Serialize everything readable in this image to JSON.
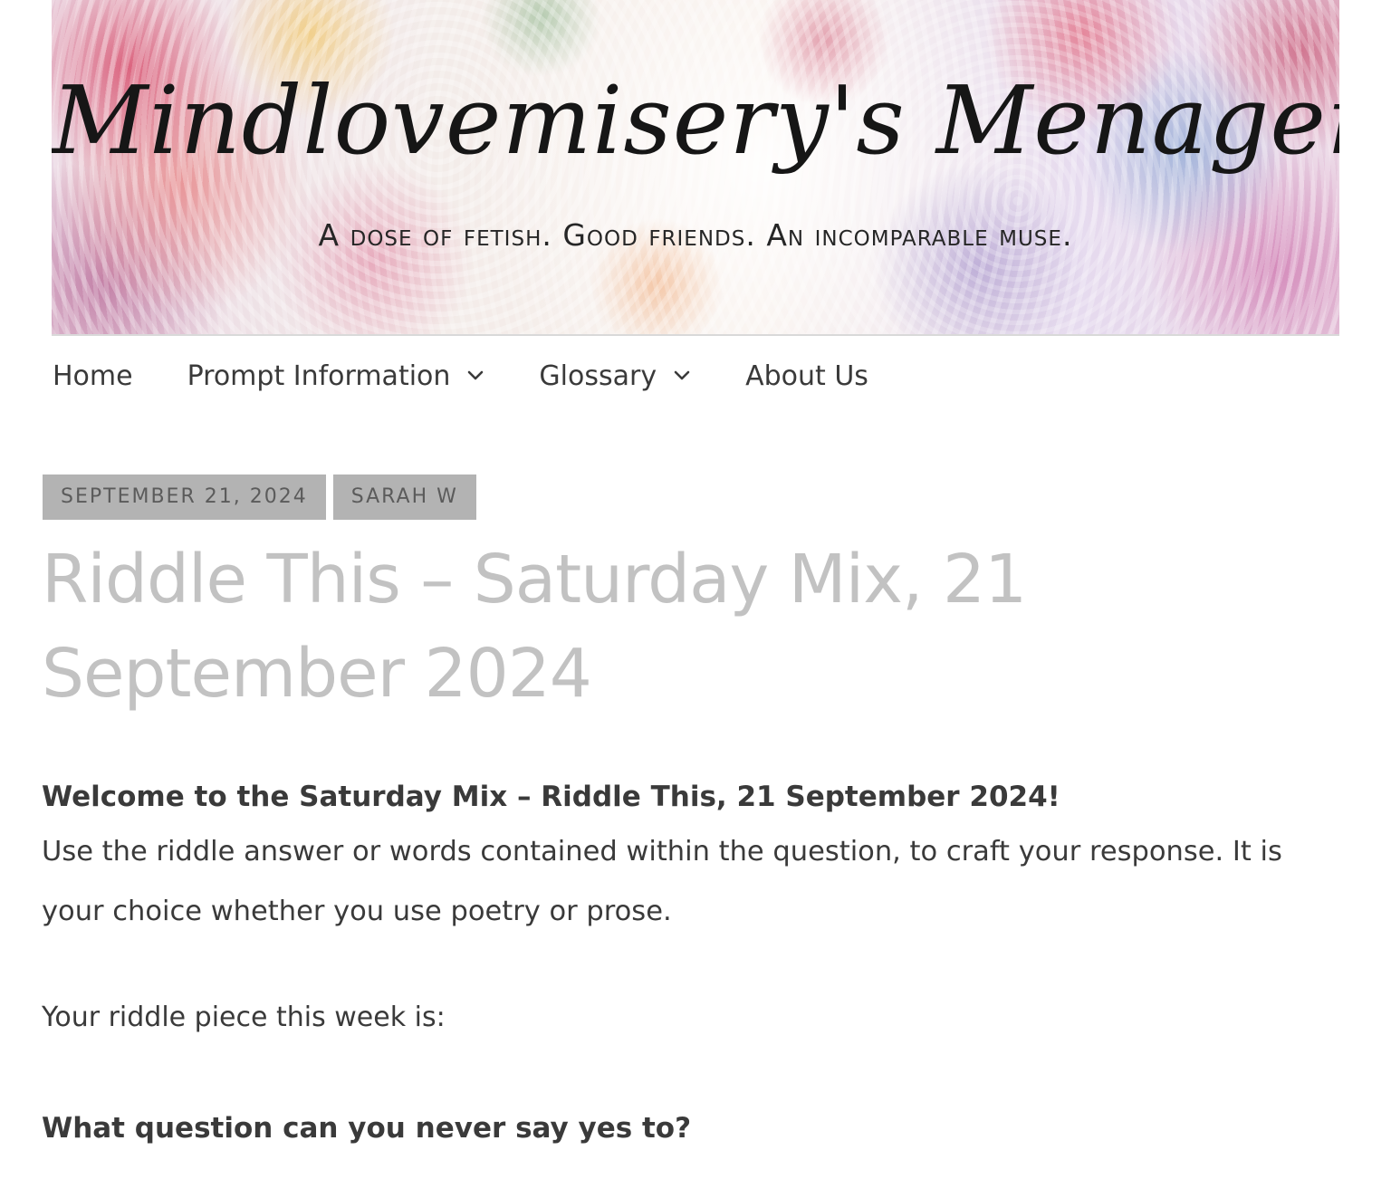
{
  "site": {
    "title": "Mindlovemisery's Menagerie",
    "tagline": "A dose of fetish. Good friends. An incomparable muse."
  },
  "nav": {
    "items": [
      {
        "label": "Home",
        "has_dropdown": false,
        "icon": "none"
      },
      {
        "label": "Prompt Information",
        "has_dropdown": true,
        "icon": "chevron-down-icon"
      },
      {
        "label": "Glossary",
        "has_dropdown": true,
        "icon": "chevron-down-icon"
      },
      {
        "label": "About Us",
        "has_dropdown": false,
        "icon": "none"
      }
    ]
  },
  "post": {
    "date": "SEPTEMBER 21, 2024",
    "author": "SARAH W",
    "title": "Riddle This – Saturday Mix, 21 September 2024",
    "welcome": "Welcome to the Saturday Mix – Riddle This, 21 September 2024!",
    "instructions": "Use the riddle answer or words contained within the question, to craft your response. It is your choice whether you use poetry or prose.",
    "riddle_intro": "Your riddle piece this week is:",
    "riddle_question": "What question can you never say yes to?"
  },
  "colors": {
    "badge_bg": "#b3b3b3",
    "badge_text": "#5b5b5b",
    "title_text": "#c2c2c2",
    "body_text": "#3a3a3a"
  }
}
